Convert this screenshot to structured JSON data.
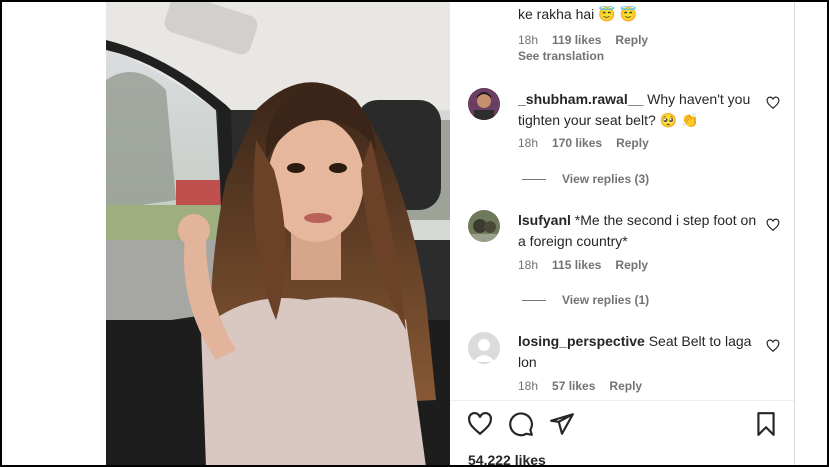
{
  "comments_top": {
    "partial_text": "ke rakha hai 😇 😇",
    "time": "18h",
    "likes": "119 likes",
    "reply": "Reply",
    "see_translation": "See translation"
  },
  "comments": [
    {
      "username": "_shubham.rawal__",
      "text": "Why haven't you tighten your seat belt? 🥺 👏",
      "time": "18h",
      "likes": "170 likes",
      "reply": "Reply",
      "view_replies": "View replies (3)"
    },
    {
      "username": "lsufyanl",
      "text": "*Me the second i step foot on a foreign country*",
      "time": "18h",
      "likes": "115 likes",
      "reply": "Reply",
      "view_replies": "View replies (1)"
    },
    {
      "username": "losing_perspective",
      "text": "Seat Belt to laga lon",
      "time": "18h",
      "likes": "57 likes",
      "reply": "Reply"
    }
  ],
  "footer": {
    "likes_count": "54,222 likes"
  },
  "icons": {
    "like": "heart-icon",
    "comment": "comment-icon",
    "share": "send-icon",
    "save": "bookmark-icon"
  },
  "colors": {
    "text": "#262626",
    "muted": "#737373"
  }
}
